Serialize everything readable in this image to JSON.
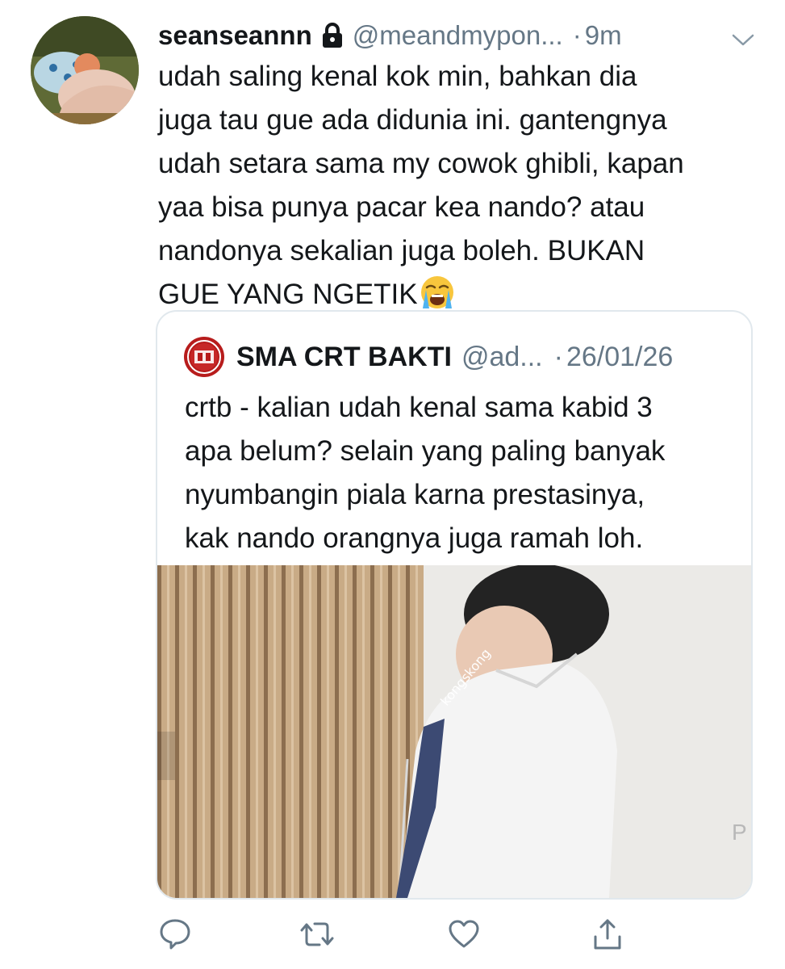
{
  "tweet": {
    "display_name": "seanseannn",
    "handle": "@meandmypon...",
    "separator": "·",
    "time": "9m",
    "text": "udah saling kenal kok min, bahkan dia\njuga tau gue ada didunia ini. gantengnya\nudah setara sama my cowok ghibli, kapan\nyaa bisa punya pacar kea nando? atau\nnandonya sekalian juga boleh. BUKAN\nGUE YANG NGETIK"
  },
  "quote": {
    "display_name": "SMA CRT BAKTI",
    "handle": "@ad...",
    "separator": "·",
    "date": "26/01/26",
    "text": "crtb - kalian udah kenal sama kabid 3\napa belum? selain yang paling banyak\nnyumbangin piala karna prestasinya,\nkak nando orangnya juga ramah loh.",
    "image_watermark": "kongskong"
  },
  "icons": {
    "lock": "lock-icon",
    "caret": "chevron-down-icon",
    "emoji": "loudly-crying-face-icon",
    "reply": "reply-icon",
    "retweet": "retweet-icon",
    "like": "heart-icon",
    "share": "share-icon"
  },
  "colors": {
    "text": "#14171a",
    "secondary": "#657786",
    "action_icon": "#657786",
    "border": "#e1e8ed",
    "quote_avatar": "#b71c1c"
  }
}
